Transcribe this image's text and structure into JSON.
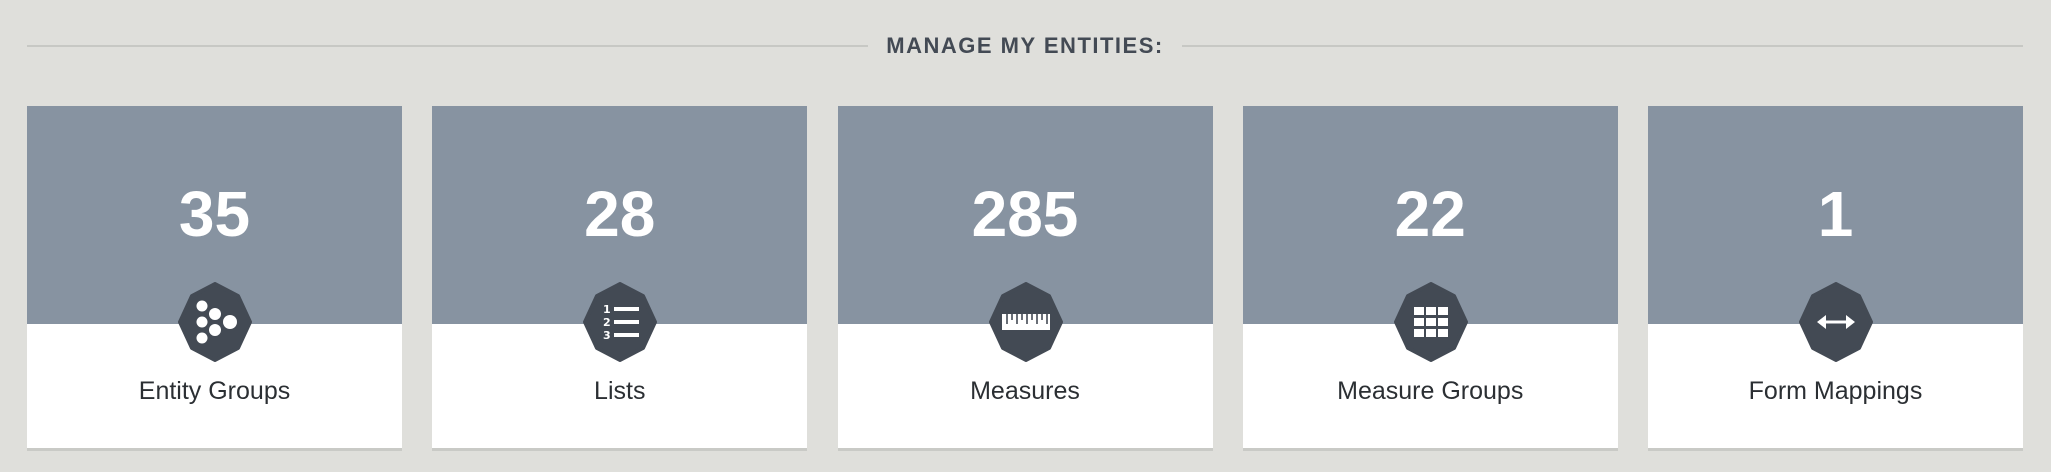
{
  "header": {
    "title": "MANAGE MY ENTITIES:"
  },
  "cards": [
    {
      "count": "35",
      "label": "Entity Groups",
      "icon": "entity-groups-icon"
    },
    {
      "count": "28",
      "label": "Lists",
      "icon": "numbered-list-icon"
    },
    {
      "count": "285",
      "label": "Measures",
      "icon": "ruler-icon"
    },
    {
      "count": "22",
      "label": "Measure Groups",
      "icon": "grid-icon"
    },
    {
      "count": "1",
      "label": "Form Mappings",
      "icon": "double-arrow-icon"
    }
  ],
  "colors": {
    "background": "#dfdfdb",
    "card_top": "#8793a1",
    "card_bottom": "#ffffff",
    "icon_hex": "#434a54",
    "heading": "#434a54"
  }
}
